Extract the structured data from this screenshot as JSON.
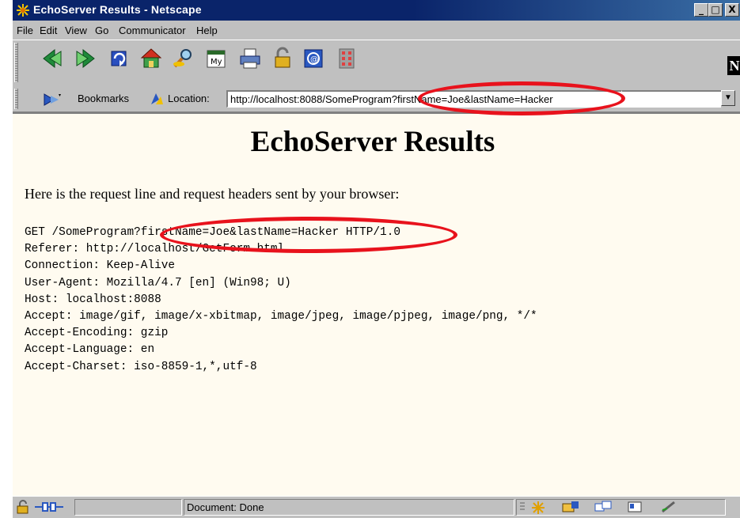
{
  "window": {
    "title": "EchoServer Results - Netscape",
    "min_symbol": "_",
    "max_symbol": "□",
    "close_symbol": "X"
  },
  "menu": [
    "File",
    "Edit",
    "View",
    "Go",
    "Communicator",
    "Help"
  ],
  "toolbar": {
    "buttons": [
      "back-icon",
      "forward-icon",
      "reload-icon",
      "home-icon",
      "search-icon",
      "my-netscape-icon",
      "print-icon",
      "security-icon",
      "shop-icon",
      "stop-icon"
    ],
    "netscape_logo": "N"
  },
  "location_bar": {
    "bookmarks_label": "Bookmarks",
    "location_label": "Location:",
    "url": "http://localhost:8088/SomeProgram?firstName=Joe&lastName=Hacker"
  },
  "page": {
    "heading": "EchoServer Results",
    "intro": "Here is the request line and request headers sent by your browser:",
    "request_lines": [
      "GET /SomeProgram?firstName=Joe&lastName=Hacker HTTP/1.0",
      "Referer: http://localhost/GetForm.html",
      "Connection: Keep-Alive",
      "User-Agent: Mozilla/4.7 [en] (Win98; U)",
      "Host: localhost:8088",
      "Accept: image/gif, image/x-xbitmap, image/jpeg, image/pjpeg, image/png, */*",
      "Accept-Encoding: gzip",
      "Accept-Language: en",
      "Accept-Charset: iso-8859-1,*,utf-8"
    ]
  },
  "status": {
    "text": "Document: Done",
    "component_icons": [
      "navigator-icon",
      "mail-icon",
      "discussions-icon",
      "address-book-icon",
      "composer-icon"
    ]
  },
  "colors": {
    "titlebar": "#0a246a",
    "page_background": "#fffbf0",
    "highlight_oval": "#e8121c"
  }
}
